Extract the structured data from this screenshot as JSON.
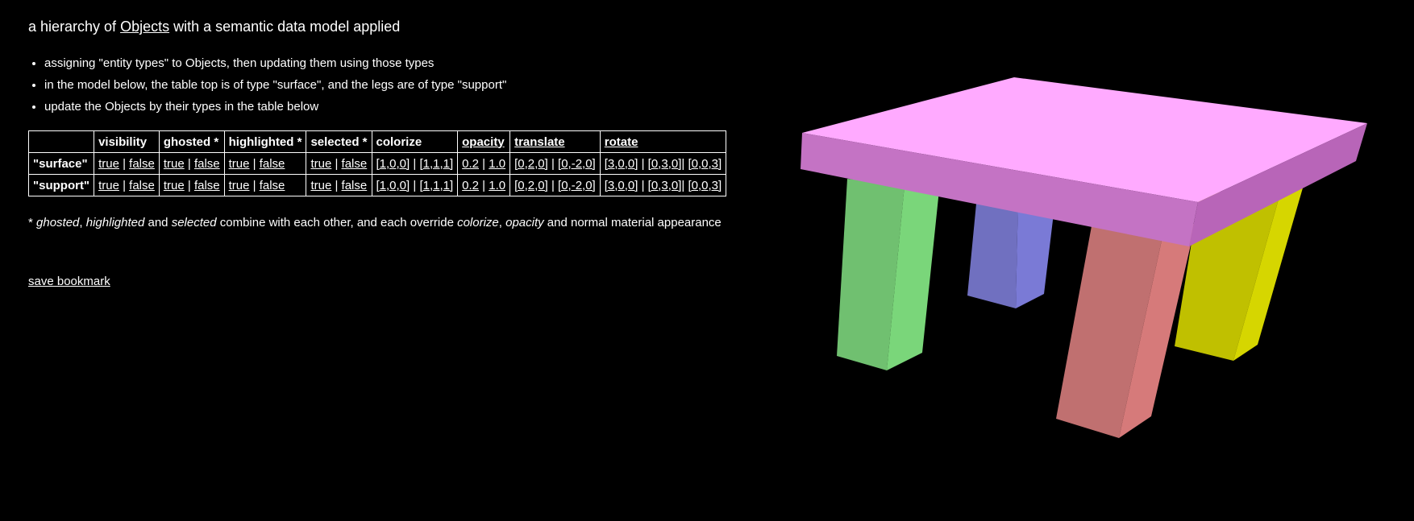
{
  "header": {
    "prefix": "a hierarchy of ",
    "link": "Objects",
    "suffix": " with a semantic data model applied"
  },
  "bullets": [
    "assigning \"entity types\" to Objects, then updating them using those types",
    "in the model below, the table top is of type \"surface\", and the legs are of type \"support\"",
    "update the Objects by their types in the table below"
  ],
  "table": {
    "columns": [
      "",
      "visibility",
      "ghosted *",
      "highlighted *",
      "selected *",
      "colorize",
      "opacity",
      "translate",
      "rotate"
    ],
    "rows": [
      {
        "label": "\"surface\"",
        "visibility": [
          "true",
          "false"
        ],
        "ghosted": [
          "true",
          "false"
        ],
        "highlighted": [
          "true",
          "false"
        ],
        "selected": [
          "true",
          "false"
        ],
        "colorize": [
          "[1,0,0]",
          "[1,1,1]"
        ],
        "opacity": [
          "0.2",
          "1.0"
        ],
        "translate": [
          "[0,2,0]",
          "[0,-2,0]"
        ],
        "rotate": [
          "[3,0,0]",
          "[0,3,0]",
          "[0,0,3]"
        ]
      },
      {
        "label": "\"support\"",
        "visibility": [
          "true",
          "false"
        ],
        "ghosted": [
          "true",
          "false"
        ],
        "highlighted": [
          "true",
          "false"
        ],
        "selected": [
          "true",
          "false"
        ],
        "colorize": [
          "[1,0,0]",
          "[1,1,1]"
        ],
        "opacity": [
          "0.2",
          "1.0"
        ],
        "translate": [
          "[0,2,0]",
          "[0,-2,0]"
        ],
        "rotate": [
          "[3,0,0]",
          "[0,3,0]",
          "[0,0,3]"
        ]
      }
    ],
    "sep": " | ",
    "sep_rot2": "| "
  },
  "note": {
    "star": "* ",
    "ghosted": "ghosted",
    "comma1": ", ",
    "highlighted": "highlighted",
    "and1": " and ",
    "selected": "selected",
    "mid": " combine with each other, and each override ",
    "colorize": "colorize",
    "comma2": ", ",
    "opacity": "opacity",
    "end": " and normal material appearance"
  },
  "bookmark": "save bookmark",
  "scene": {
    "colors": {
      "top": "#ffaaff",
      "top_front": "#c473c4",
      "top_side": "#b865b8",
      "leg_green": "#70c070",
      "leg_green_side": "#7ad67a",
      "leg_blue": "#7070c0",
      "leg_blue_side": "#7a7ad6",
      "leg_red": "#c07070",
      "leg_red_side": "#d67a7a",
      "leg_yellow": "#c0c000",
      "leg_yellow_side": "#d6d600"
    }
  }
}
